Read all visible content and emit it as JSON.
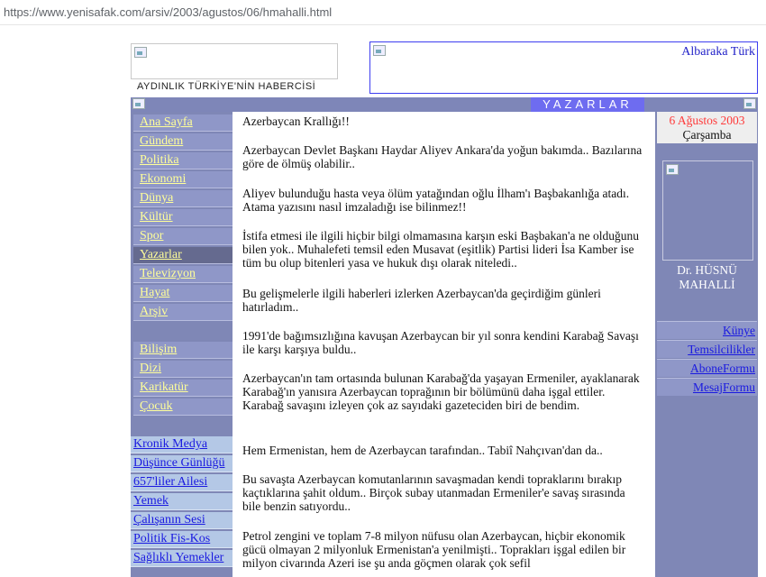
{
  "browser": {
    "url": "https://www.yenisafak.com/arsiv/2003/agustos/06/hmahalli.html"
  },
  "header": {
    "tagline": "AYDINLIK TÜRKİYE'NİN HABERCİSİ",
    "ad_text": "Albaraka Türk",
    "section_title": "YAZARLAR"
  },
  "nav_main": [
    {
      "label": "Ana Sayfa"
    },
    {
      "label": "Gündem"
    },
    {
      "label": "Politika"
    },
    {
      "label": "Ekonomi"
    },
    {
      "label": "Dünya"
    },
    {
      "label": "Kültür"
    },
    {
      "label": "Spor"
    },
    {
      "label": "Yazarlar"
    },
    {
      "label": "Televizyon"
    },
    {
      "label": "Hayat"
    },
    {
      "label": "Arşiv"
    }
  ],
  "nav_secondary": [
    {
      "label": "Bilişim"
    },
    {
      "label": "Dizi"
    },
    {
      "label": "Karikatür"
    },
    {
      "label": "Çocuk"
    }
  ],
  "nav_special": [
    {
      "label": "Kronik Medya"
    },
    {
      "label": "Düşünce Günlüğü"
    },
    {
      "label": "657'liler Ailesi"
    },
    {
      "label": "Yemek"
    },
    {
      "label": "Çalışanın Sesi"
    },
    {
      "label": "Politik Fis-Kos"
    },
    {
      "label": "Sağlıklı Yemekler"
    }
  ],
  "sidebar_right": {
    "date": "6 Ağustos 2003",
    "weekday": "Çarşamba",
    "author_line1": "Dr. HÜSNÜ",
    "author_line2": "MAHALLİ",
    "links": [
      {
        "label": "Künye"
      },
      {
        "label": "Temsilcilikler"
      },
      {
        "label": "AboneFormu"
      },
      {
        "label": "MesajFormu"
      }
    ]
  },
  "article": {
    "paragraphs": [
      "Azerbaycan Krallığı!!",
      "Azerbaycan Devlet Başkanı Haydar Aliyev Ankara'da yoğun bakımda.. Bazılarına göre de ölmüş olabilir..",
      "Aliyev bulunduğu hasta veya ölüm yatağından oğlu İlham'ı Başbakanlığa atadı. Atama yazısını nasıl imzaladığı ise bilinmez!!",
      "İstifa etmesi ile ilgili hiçbir bilgi olmamasına karşın eski Başbakan'a ne olduğunu bilen yok.. Muhalefeti temsil eden Musavat (eşitlik) Partisi lideri İsa Kamber ise tüm bu olup bitenleri yasa ve hukuk dışı olarak niteledi..",
      "Bu gelişmelerle ilgili haberleri izlerken Azerbaycan'da geçirdiğim günleri hatırladım..",
      "1991'de bağımsızlığına kavuşan Azerbaycan bir yıl sonra kendini Karabağ Savaşı ile karşı karşıya buldu..",
      "Azerbaycan'ın tam ortasında bulunan Karabağ'da yaşayan Ermeniler, ayaklanarak Karabağ'ın yanısıra Azerbaycan toprağının bir bölümünü daha işgal ettiler. Karabağ savaşını izleyen çok az sayıdaki gazeteciden biri de bendim.",
      "Hem Ermenistan, hem de Azerbaycan tarafından.. Tabiî Nahçıvan'dan da..",
      "Bu savaşta Azerbaycan komutanlarının savaşmadan kendi topraklarını bırakıp kaçtıklarına şahit oldum.. Birçok subay utanmadan Ermeniler'e savaş sırasında bile benzin satıyordu..",
      "Petrol zengini ve toplam 7-8 milyon nüfusu olan Azerbaycan, hiçbir ekonomik gücü olmayan 2 milyonluk Ermenistan'a yenilmişti.. Toprakları işgal edilen bir milyon civarında Azeri ise şu anda göçmen olarak çok sefil"
    ]
  },
  "colors": {
    "nav_text": "#ffff99",
    "link_blue": "#1a1ae0",
    "date_red": "#ff3a3a",
    "bar": "#7e86b8",
    "section_bar": "#6e6cf0"
  }
}
